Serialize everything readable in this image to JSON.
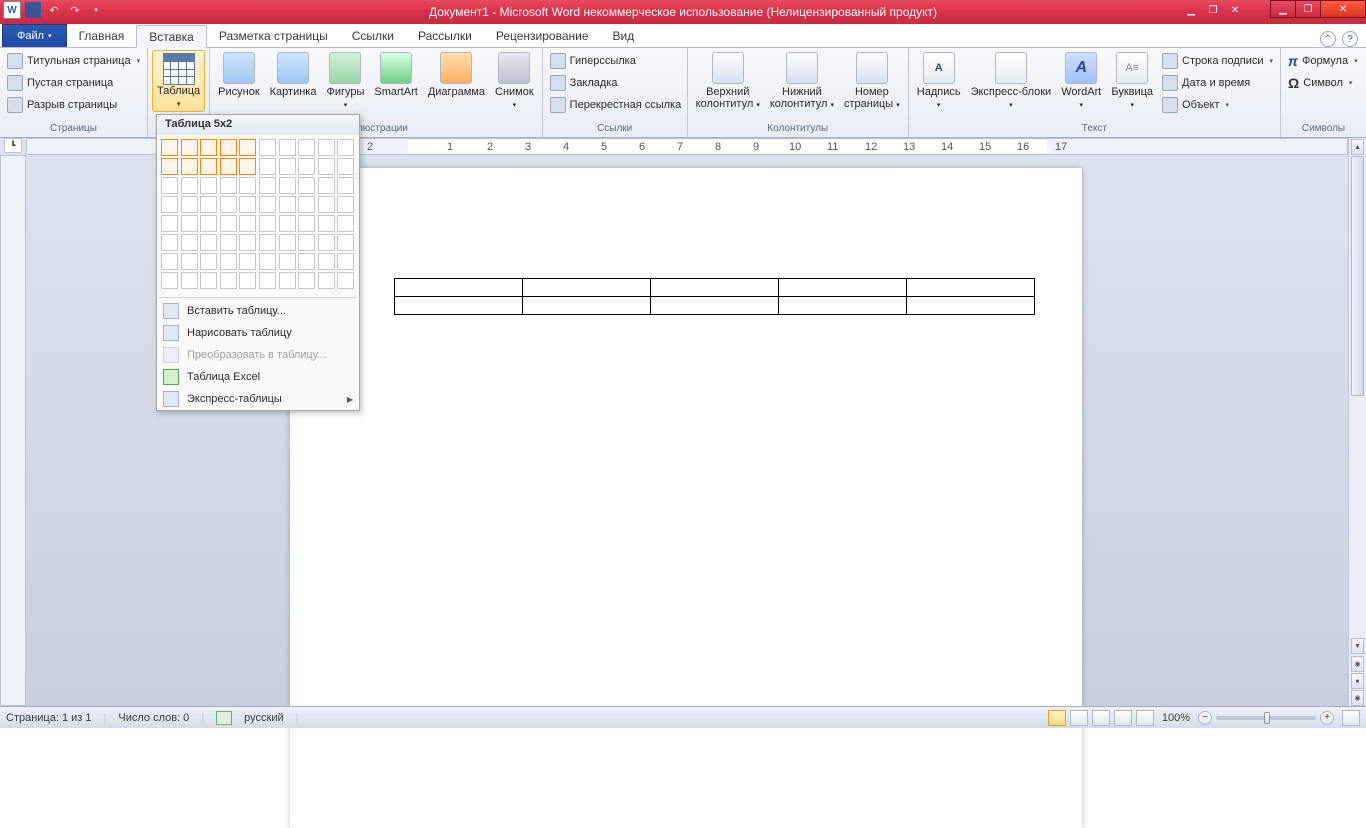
{
  "title": "Документ1 - Microsoft Word некоммерческое использование (Нелицензированный продукт)",
  "tabs": {
    "file": "Файл",
    "home": "Главная",
    "insert": "Вставка",
    "layout": "Разметка страницы",
    "refs": "Ссылки",
    "mail": "Рассылки",
    "review": "Рецензирование",
    "view": "Вид"
  },
  "groups": {
    "pages": {
      "label": "Страницы",
      "cover": "Титульная страница",
      "blank": "Пустая страница",
      "break": "Разрыв страницы"
    },
    "tables": {
      "label": "Таблицы",
      "table": "Таблица"
    },
    "illustrations": {
      "label": "Иллюстрации",
      "picture": "Рисунок",
      "clipart": "Картинка",
      "shapes": "Фигуры",
      "smartart": "SmartArt",
      "chart": "Диаграмма",
      "screenshot": "Снимок"
    },
    "links": {
      "label": "Ссылки",
      "hyper": "Гиперссылка",
      "bookmark": "Закладка",
      "crossref": "Перекрестная ссылка"
    },
    "hf": {
      "label": "Колонтитулы",
      "header": "Верхний\nколонтитул",
      "footer": "Нижний\nколонтитул",
      "pagenum": "Номер\nстраницы"
    },
    "text": {
      "label": "Текст",
      "textbox": "Надпись",
      "quick": "Экспресс-блоки",
      "wordart": "WordArt",
      "dropcap": "Буквица",
      "sigline": "Строка подписи",
      "datetime": "Дата и время",
      "object": "Объект"
    },
    "symbols": {
      "label": "Символы",
      "equation": "Формула",
      "symbol": "Символ"
    }
  },
  "table_dropdown": {
    "header": "Таблица 5x2",
    "selected_cols": 5,
    "selected_rows": 2,
    "grid_cols": 10,
    "grid_rows": 8,
    "insert": "Вставить таблицу...",
    "draw": "Нарисовать таблицу",
    "convert": "Преобразовать в таблицу...",
    "excel": "Таблица Excel",
    "quick": "Экспресс-таблицы"
  },
  "ruler_numbers": [
    "1",
    "2",
    "1",
    "2",
    "3",
    "4",
    "5",
    "6",
    "7",
    "8",
    "9",
    "10",
    "11",
    "12",
    "13",
    "14",
    "15",
    "16",
    "17"
  ],
  "doc_table": {
    "rows": 2,
    "cols": 5
  },
  "status": {
    "page": "Страница: 1 из 1",
    "words": "Число слов: 0",
    "lang": "русский",
    "zoom": "100%"
  }
}
